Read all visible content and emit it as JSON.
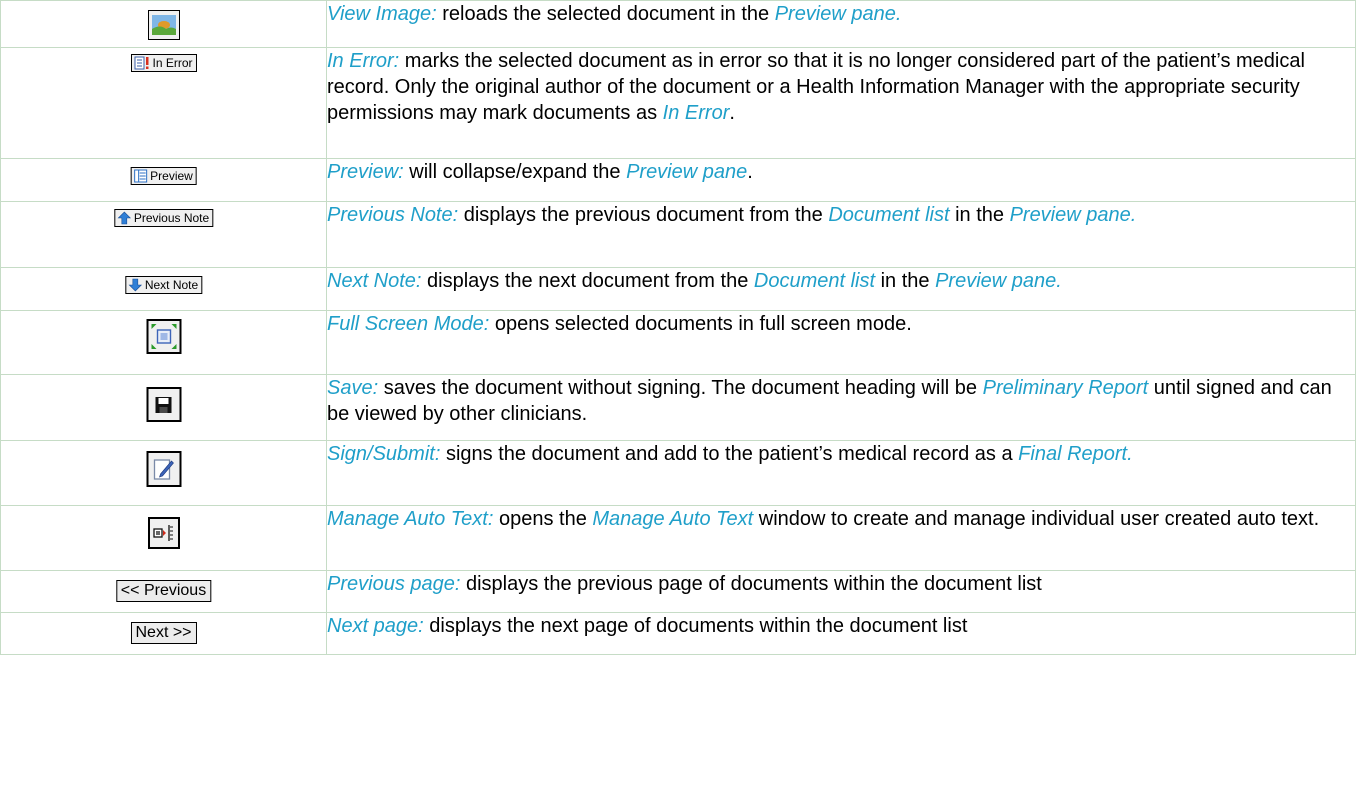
{
  "rows": [
    {
      "icon": "image-icon",
      "title": "View Image:",
      "parts": [
        {
          "t": "title",
          "v": "View Image:"
        },
        {
          "t": "text",
          "v": " reloads the selected document in the "
        },
        {
          "t": "term",
          "v": "Preview pane."
        }
      ]
    },
    {
      "icon": "in-error-icon",
      "button_label": "In Error",
      "parts": [
        {
          "t": "title",
          "v": "In Error:"
        },
        {
          "t": "text",
          "v": " marks the selected document as in error so that it is no longer considered part of the patient’s medical record.  Only the original author of the document or a Health Information Manager with the appropriate security permissions may mark documents as "
        },
        {
          "t": "term",
          "v": "In Error"
        },
        {
          "t": "text",
          "v": "."
        }
      ]
    },
    {
      "icon": "preview-icon",
      "button_label": "Preview",
      "parts": [
        {
          "t": "title",
          "v": "Preview:"
        },
        {
          "t": "text",
          "v": " will collapse/expand the "
        },
        {
          "t": "term",
          "v": "Preview pane"
        },
        {
          "t": "text",
          "v": "."
        }
      ]
    },
    {
      "icon": "previous-note-icon",
      "button_label": "Previous Note",
      "parts": [
        {
          "t": "title",
          "v": "Previous Note:"
        },
        {
          "t": "text",
          "v": " displays the previous document from the "
        },
        {
          "t": "term",
          "v": "Document list"
        },
        {
          "t": "text",
          "v": " in the "
        },
        {
          "t": "term",
          "v": "Preview pane."
        }
      ]
    },
    {
      "icon": "next-note-icon",
      "button_label": "Next Note",
      "parts": [
        {
          "t": "title",
          "v": "Next Note:"
        },
        {
          "t": "text",
          "v": " displays the next document from the "
        },
        {
          "t": "term",
          "v": "Document list"
        },
        {
          "t": "text",
          "v": " in the "
        },
        {
          "t": "term",
          "v": "Preview pane."
        }
      ]
    },
    {
      "icon": "full-screen-icon",
      "parts": [
        {
          "t": "title",
          "v": "Full Screen Mode:"
        },
        {
          "t": "text",
          "v": " opens selected documents in full screen mode."
        }
      ]
    },
    {
      "icon": "save-icon",
      "parts": [
        {
          "t": "title",
          "v": "Save:"
        },
        {
          "t": "text",
          "v": " saves the document without signing. The document heading will be "
        },
        {
          "t": "term",
          "v": "Preliminary Report"
        },
        {
          "t": "text",
          "v": " until signed and can be viewed by other clinicians."
        }
      ]
    },
    {
      "icon": "sign-submit-icon",
      "parts": [
        {
          "t": "title",
          "v": "Sign/Submit:"
        },
        {
          "t": "text",
          "v": " signs the document and add to the patient’s medical record as a "
        },
        {
          "t": "term",
          "v": "Final Report."
        }
      ]
    },
    {
      "icon": "manage-auto-text-icon",
      "parts": [
        {
          "t": "title",
          "v": "Manage Auto Text:"
        },
        {
          "t": "text",
          "v": " opens the "
        },
        {
          "t": "term",
          "v": "Manage Auto Text"
        },
        {
          "t": "text",
          "v": " window to create and manage individual user created auto text."
        }
      ]
    },
    {
      "icon": "previous-page-icon",
      "button_label": "<< Previous",
      "parts": [
        {
          "t": "title",
          "v": "Previous page:"
        },
        {
          "t": "text",
          "v": " displays the previous page of documents within the document list"
        }
      ]
    },
    {
      "icon": "next-page-icon",
      "button_label": "Next >>",
      "parts": [
        {
          "t": "title",
          "v": "Next page:"
        },
        {
          "t": "text",
          "v": " displays the next page of documents within the document list"
        }
      ]
    }
  ]
}
